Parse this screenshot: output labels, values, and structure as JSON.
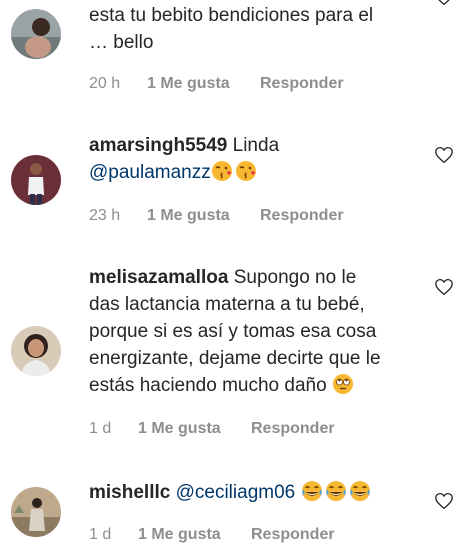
{
  "comments": [
    {
      "username": "",
      "text_line1": "esta tu bebito bendiciones para el",
      "text_line2": "… bello",
      "time": "20 h",
      "likes": "1 Me gusta",
      "reply": "Responder"
    },
    {
      "username": "amarsingh5549",
      "text": "Linda",
      "mention": "@paulamanzz",
      "emojis": [
        "kiss-face-icon",
        "kiss-face-icon"
      ],
      "time": "23 h",
      "likes": "1 Me gusta",
      "reply": "Responder"
    },
    {
      "username": "melisazamalloa",
      "text_line1": "Supongo no le",
      "text_line2": "das lactancia materna a tu bebé,",
      "text_line3": "porque si es así y tomas esa cosa",
      "text_line4": "energizante, dejame decirte que le",
      "text_line5": "estás haciendo mucho daño",
      "emojis": [
        "eye-roll-face-icon"
      ],
      "time": "1 d",
      "likes": "1 Me gusta",
      "reply": "Responder"
    },
    {
      "username": "mishelllc",
      "mention": "@ceciliagm06",
      "emojis": [
        "tears-of-joy-face-icon",
        "tears-of-joy-face-icon",
        "tears-of-joy-face-icon"
      ],
      "time": "1 d",
      "likes": "1 Me gusta",
      "reply": "Responder"
    }
  ],
  "colors": {
    "text": "#262626",
    "meta": "#8e8e8e",
    "mention": "#00376b",
    "emoji": "#f7b731"
  }
}
